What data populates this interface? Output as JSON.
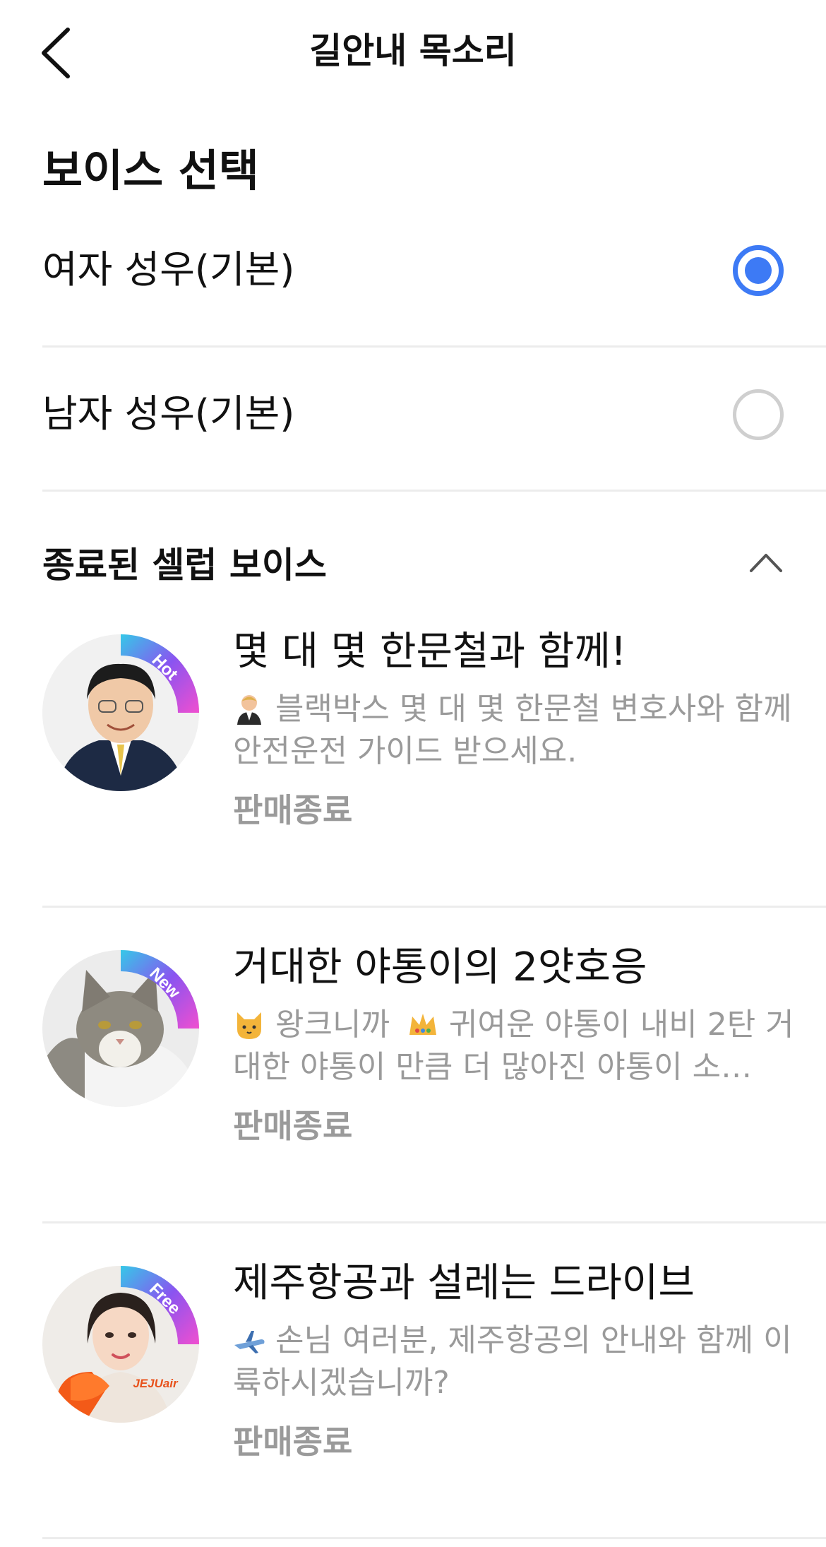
{
  "header": {
    "title": "길안내 목소리"
  },
  "voice_section": {
    "title": "보이스 선택"
  },
  "voices": [
    {
      "label": "여자 성우(기본)",
      "selected": true
    },
    {
      "label": "남자 성우(기본)",
      "selected": false
    }
  ],
  "celeb_section": {
    "title": "종료된 셀럽 보이스",
    "expanded": true
  },
  "celeb_items": [
    {
      "badge": "Hot",
      "title": "몇 대 몇 한문철과 함께!",
      "emoji": "judge-emoji",
      "desc": "블랙박스 몇 대 몇 한문철 변호사와 함께 안전운전 가이드 받으세요.",
      "status": "판매종료"
    },
    {
      "badge": "New",
      "title": "거대한 야통이의 2얏호응",
      "emoji": "cat-emoji",
      "desc_prefix": "왕크니까",
      "emoji2": "crown-emoji",
      "desc": "귀여운 야통이 내비 2탄 거대한 야통이 만큼 더 많아진 야통이 소…",
      "status": "판매종료"
    },
    {
      "badge": "Free",
      "title": "제주항공과 설레는 드라이브",
      "emoji": "airplane-emoji",
      "desc": "손님 여러분, 제주항공의 안내와 함께 이륙하시겠습니까?",
      "avatar_text": "JEJUair",
      "status": "판매종료"
    }
  ],
  "colors": {
    "accent": "#3d7af5",
    "muted": "#9a9a9a",
    "divider": "#ececec"
  }
}
